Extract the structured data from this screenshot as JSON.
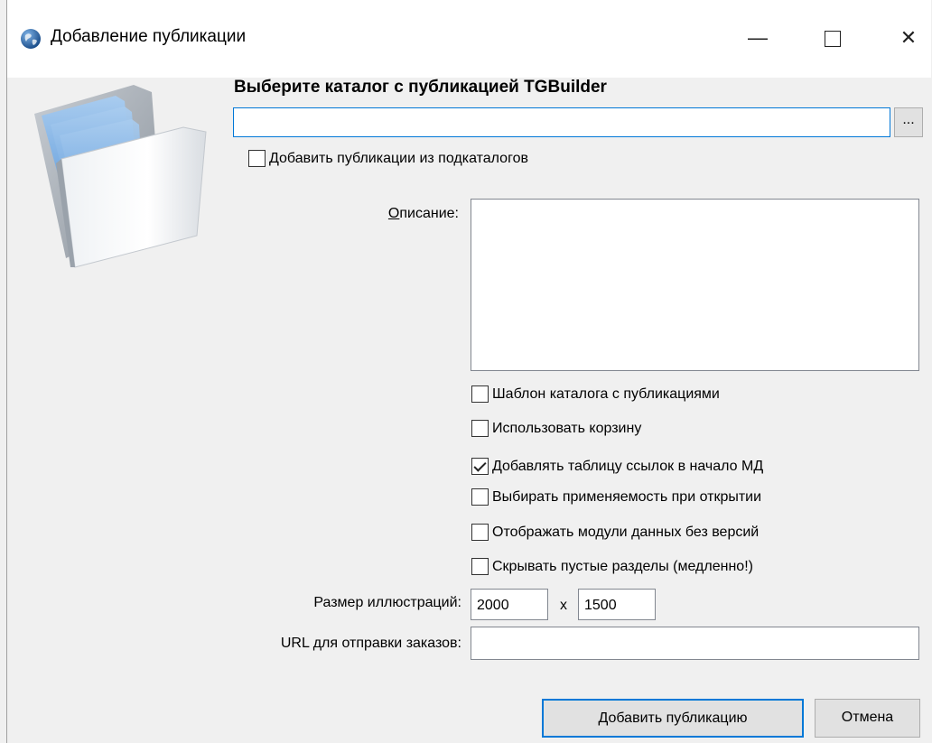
{
  "window": {
    "title": "Добавление публикации",
    "controls": {
      "minimize": "—",
      "close": "✕"
    }
  },
  "form": {
    "heading": "Выберите каталог с публикацией TGBuilder",
    "path_value": "",
    "browse_label": "...",
    "subfolders_label": "Добавить публикации из подкаталогов",
    "description_label": "Описание:",
    "description_mnemonic": "О",
    "description_rest": "писание:",
    "options": [
      {
        "label": "Шаблон каталога с публикациями",
        "checked": false
      },
      {
        "label": "Использовать корзину",
        "checked": false
      },
      {
        "label": "Добавлять таблицу ссылок в начало МД",
        "checked": true
      },
      {
        "label": "Выбирать применяемость при открытии",
        "checked": false
      },
      {
        "label": "Отображать модули данных без версий",
        "checked": false
      },
      {
        "label": "Скрывать пустые разделы (медленно!)",
        "checked": false
      }
    ],
    "image_size_label": "Размер иллюстраций:",
    "image_width": "2000",
    "size_separator": "x",
    "image_height": "1500",
    "order_url_label": "URL для отправки заказов:",
    "order_url_value": ""
  },
  "buttons": {
    "add": "Добавить публикацию",
    "cancel": "Отмена"
  },
  "colors": {
    "accent": "#0078d7",
    "dialog_bg": "#f0f0f0",
    "titlebar_bg": "#ffffff"
  },
  "icons": {
    "app": "globe-icon",
    "illustration": "folder-icon"
  }
}
